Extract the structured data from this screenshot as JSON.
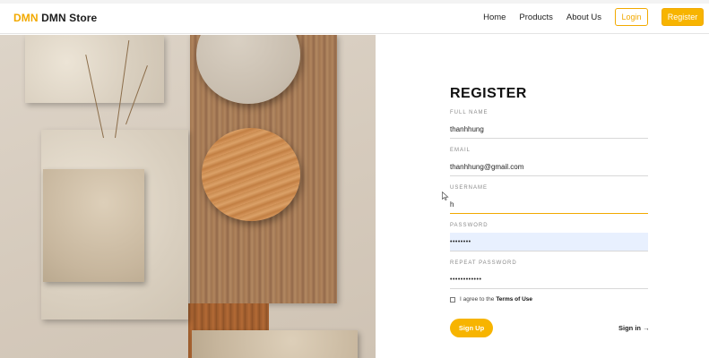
{
  "brand": {
    "accent": "DMN",
    "name": "DMN Store"
  },
  "nav": {
    "links": [
      "Home",
      "Products",
      "About Us"
    ],
    "login_label": "Login",
    "register_label": "Register"
  },
  "form": {
    "title": "REGISTER",
    "fields": [
      {
        "label": "FULL NAME",
        "value": "thanhhung"
      },
      {
        "label": "EMAIL",
        "value": "thanhhung@gmail.com"
      },
      {
        "label": "USERNAME",
        "value": "h"
      },
      {
        "label": "PASSWORD",
        "value": "••••••••"
      },
      {
        "label": "REPEAT PASSWORD",
        "value": "••••••••••••"
      }
    ],
    "terms_prefix": "I agree to the",
    "terms_link": "Terms of Use",
    "signup_label": "Sign Up",
    "signin_label": "Sign in →"
  },
  "colors": {
    "accent": "#f2a900",
    "accent_fill": "#f7b400",
    "autofill": "#e8f0fe"
  },
  "icons": {
    "cursor": "mouse-pointer-icon"
  }
}
